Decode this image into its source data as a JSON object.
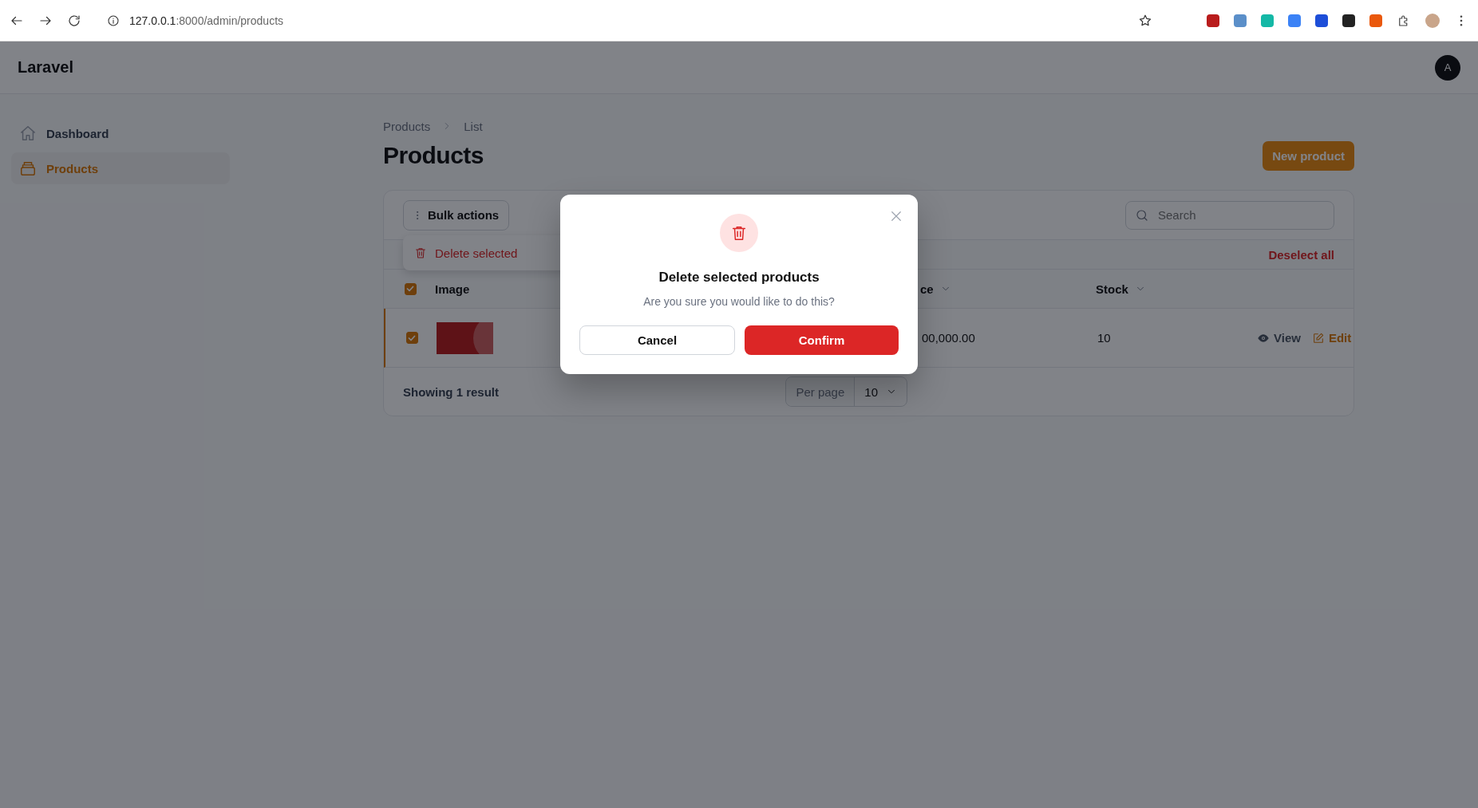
{
  "browser": {
    "url_host": "127.0.0.1",
    "url_path": ":8000/admin/products"
  },
  "app": {
    "brand": "Laravel",
    "avatar": "A"
  },
  "sidebar": {
    "items": [
      {
        "label": "Dashboard",
        "kind": "home",
        "selected": false
      },
      {
        "label": "Products",
        "kind": "box",
        "selected": true
      }
    ]
  },
  "breadcrumb": [
    "Products",
    "List"
  ],
  "title": "Products",
  "new_button": "New product",
  "table": {
    "bulk_actions": "Bulk actions",
    "search_placeholder": "Search",
    "deselect": "Deselect all",
    "header_checked": true,
    "columns": [
      {
        "label": "Image",
        "sortable": false
      },
      {
        "label": "ce",
        "sortable": true
      },
      {
        "label": "Stock",
        "sortable": true
      }
    ],
    "rows": [
      {
        "checked": true,
        "price": "00,000.00",
        "stock": "10",
        "actions": [
          {
            "label": "View",
            "kind": "view"
          },
          {
            "label": "Edit",
            "kind": "edit"
          }
        ]
      }
    ],
    "footer": "Showing 1 result",
    "per_page_label": "Per page",
    "per_page": "10"
  },
  "dropdown": {
    "items": [
      {
        "label": "Delete selected",
        "kind": "trash"
      }
    ]
  },
  "modal": {
    "title": "Delete selected products",
    "message": "Are you sure you would like to do this?",
    "buttons": [
      {
        "label": "Cancel",
        "kind": "secondary"
      },
      {
        "label": "Confirm",
        "kind": "danger"
      }
    ]
  }
}
